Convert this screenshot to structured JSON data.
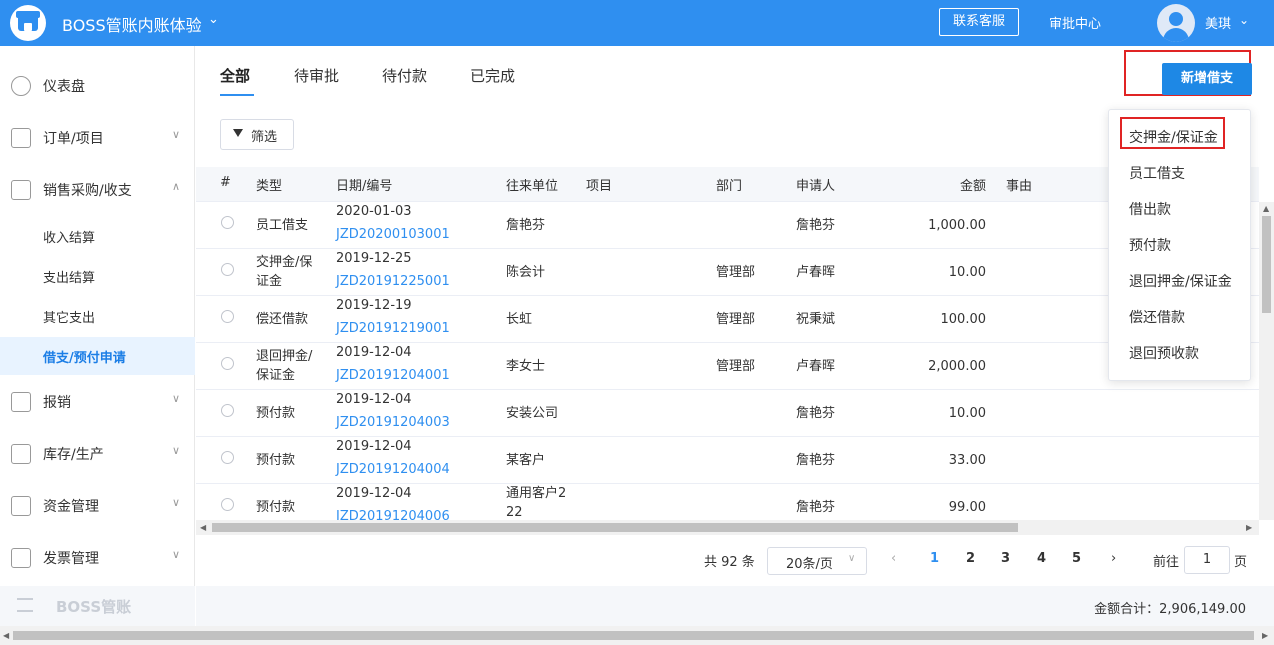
{
  "header": {
    "app_title": "BOSS管账内账体验",
    "service_button": "联系客服",
    "approval_center": "审批中心",
    "username": "美琪",
    "caret": "❯"
  },
  "sidebar": {
    "items": [
      {
        "label": "仪表盘"
      },
      {
        "label": "订单/项目"
      },
      {
        "label": "销售采购/收支"
      },
      {
        "label": "报销"
      },
      {
        "label": "库存/生产"
      },
      {
        "label": "资金管理"
      },
      {
        "label": "发票管理"
      }
    ],
    "sub_items": [
      {
        "label": "收入结算"
      },
      {
        "label": "支出结算"
      },
      {
        "label": "其它支出"
      },
      {
        "label": "借支/预付申请"
      }
    ],
    "footer_label": "BOSS管账",
    "chev_down": "∨",
    "chev_up": "∧"
  },
  "tabs": [
    {
      "label": "全部"
    },
    {
      "label": "待审批"
    },
    {
      "label": "待付款"
    },
    {
      "label": "已完成"
    }
  ],
  "toolbar": {
    "new_button": "新增借支",
    "filter_button": "筛选"
  },
  "table": {
    "headers": {
      "index": "#",
      "type": "类型",
      "date_no": "日期/编号",
      "partner": "往来单位",
      "project": "项目",
      "dept": "部门",
      "applicant": "申请人",
      "amount": "金额",
      "reason": "事由"
    },
    "rows": [
      {
        "type1": "员工借支",
        "type2": "",
        "date": "2020-01-03",
        "no": "JZD20200103001",
        "partner1": "詹艳芬",
        "partner2": "",
        "dept": "",
        "applicant": "詹艳芬",
        "amount": "1,000.00"
      },
      {
        "type1": "交押金/保",
        "type2": "证金",
        "date": "2019-12-25",
        "no": "JZD20191225001",
        "partner1": "陈会计",
        "partner2": "",
        "dept": "管理部",
        "applicant": "卢春晖",
        "amount": "10.00"
      },
      {
        "type1": "偿还借款",
        "type2": "",
        "date": "2019-12-19",
        "no": "JZD20191219001",
        "partner1": "长虹",
        "partner2": "",
        "dept": "管理部",
        "applicant": "祝秉斌",
        "amount": "100.00"
      },
      {
        "type1": "退回押金/",
        "type2": "保证金",
        "date": "2019-12-04",
        "no": "JZD20191204001",
        "partner1": "李女士",
        "partner2": "",
        "dept": "管理部",
        "applicant": "卢春晖",
        "amount": "2,000.00"
      },
      {
        "type1": "预付款",
        "type2": "",
        "date": "2019-12-04",
        "no": "JZD20191204003",
        "partner1": "安装公司",
        "partner2": "",
        "dept": "",
        "applicant": "詹艳芬",
        "amount": "10.00"
      },
      {
        "type1": "预付款",
        "type2": "",
        "date": "2019-12-04",
        "no": "JZD20191204004",
        "partner1": "某客户",
        "partner2": "",
        "dept": "",
        "applicant": "詹艳芬",
        "amount": "33.00"
      },
      {
        "type1": "预付款",
        "type2": "",
        "date": "2019-12-04",
        "no": "JZD20191204006",
        "partner1": "通用客户2",
        "partner2": "22",
        "dept": "",
        "applicant": "詹艳芬",
        "amount": "99.00"
      }
    ]
  },
  "pagination": {
    "total": "共 92 条",
    "page_size": "20条/页",
    "prev": "‹",
    "next": "›",
    "pages": [
      "1",
      "2",
      "3",
      "4",
      "5"
    ],
    "current": "1",
    "goto_label": "前往",
    "goto_value": "1",
    "goto_suffix": "页"
  },
  "summary": {
    "label": "金额合计：2,906,149.00"
  },
  "dropdown": {
    "items": [
      {
        "label": "交押金/保证金"
      },
      {
        "label": "员工借支"
      },
      {
        "label": "借出款"
      },
      {
        "label": "预付款"
      },
      {
        "label": "退回押金/保证金"
      },
      {
        "label": "偿还借款"
      },
      {
        "label": "退回预收款"
      }
    ]
  },
  "colors": {
    "primary": "#2f8ff0",
    "highlight_box": "#e02424",
    "active_bg": "#e8f3ff"
  }
}
